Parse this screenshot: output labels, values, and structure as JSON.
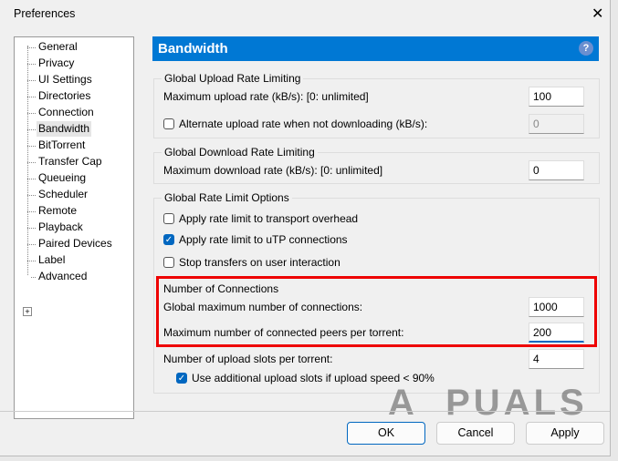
{
  "window": {
    "title": "Preferences"
  },
  "sidebar": {
    "items": [
      {
        "label": "General"
      },
      {
        "label": "Privacy"
      },
      {
        "label": "UI Settings"
      },
      {
        "label": "Directories"
      },
      {
        "label": "Connection"
      },
      {
        "label": "Bandwidth",
        "selected": true
      },
      {
        "label": "BitTorrent"
      },
      {
        "label": "Transfer Cap"
      },
      {
        "label": "Queueing"
      },
      {
        "label": "Scheduler"
      },
      {
        "label": "Remote"
      },
      {
        "label": "Playback"
      },
      {
        "label": "Paired Devices"
      },
      {
        "label": "Label"
      },
      {
        "label": "Advanced"
      }
    ]
  },
  "header": {
    "title": "Bandwidth",
    "help": "?"
  },
  "upload": {
    "group": "Global Upload Rate Limiting",
    "max_label": "Maximum upload rate (kB/s): [0: unlimited]",
    "max_value": "100",
    "alt_label": "Alternate upload rate when not downloading (kB/s):",
    "alt_checked": false,
    "alt_value": "0"
  },
  "download": {
    "group": "Global Download Rate Limiting",
    "max_label": "Maximum download rate (kB/s): [0: unlimited]",
    "max_value": "0"
  },
  "options": {
    "group": "Global Rate Limit Options",
    "items": [
      {
        "label": "Apply rate limit to transport overhead",
        "checked": false
      },
      {
        "label": "Apply rate limit to uTP connections",
        "checked": true
      },
      {
        "label": "Stop transfers on user interaction",
        "checked": false
      }
    ]
  },
  "connections": {
    "group": "Number of Connections",
    "global_label": "Global maximum number of connections:",
    "global_value": "1000",
    "peers_label": "Maximum number of connected peers per torrent:",
    "peers_value": "200",
    "slots_label": "Number of upload slots per torrent:",
    "slots_value": "4",
    "extra_label": "Use additional upload slots if upload speed < 90%",
    "extra_checked": true
  },
  "buttons": {
    "ok": "OK",
    "cancel": "Cancel",
    "apply": "Apply"
  },
  "watermark": "A PUALS"
}
